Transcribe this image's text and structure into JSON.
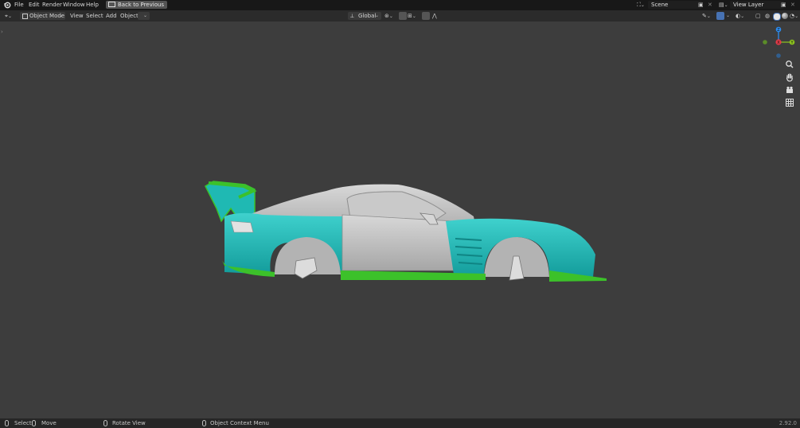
{
  "topbar": {
    "menus": [
      "File",
      "Edit",
      "Render",
      "Window",
      "Help"
    ],
    "back_button": "Back to Previous",
    "scene_name": "Scene",
    "view_layer": "View Layer"
  },
  "header": {
    "mode": "Object Mode",
    "menus": [
      "View",
      "Select",
      "Add",
      "Object"
    ],
    "orientation": "Global"
  },
  "gizmo": {
    "z_label": "Z",
    "x_label": "X",
    "y_label": "Y"
  },
  "statusbar": {
    "select": "Select",
    "move": "Move",
    "rotate": "Rotate View",
    "context": "Object Context Menu",
    "version": "2.92.0"
  },
  "colors": {
    "accent": "#4772b3",
    "teal": "#1fbab8",
    "green": "#3cc12a",
    "gray_body": "#b9b9b9",
    "axis_x": "#e23a48",
    "axis_y": "#8bc21f",
    "axis_z": "#2c8cf0"
  }
}
